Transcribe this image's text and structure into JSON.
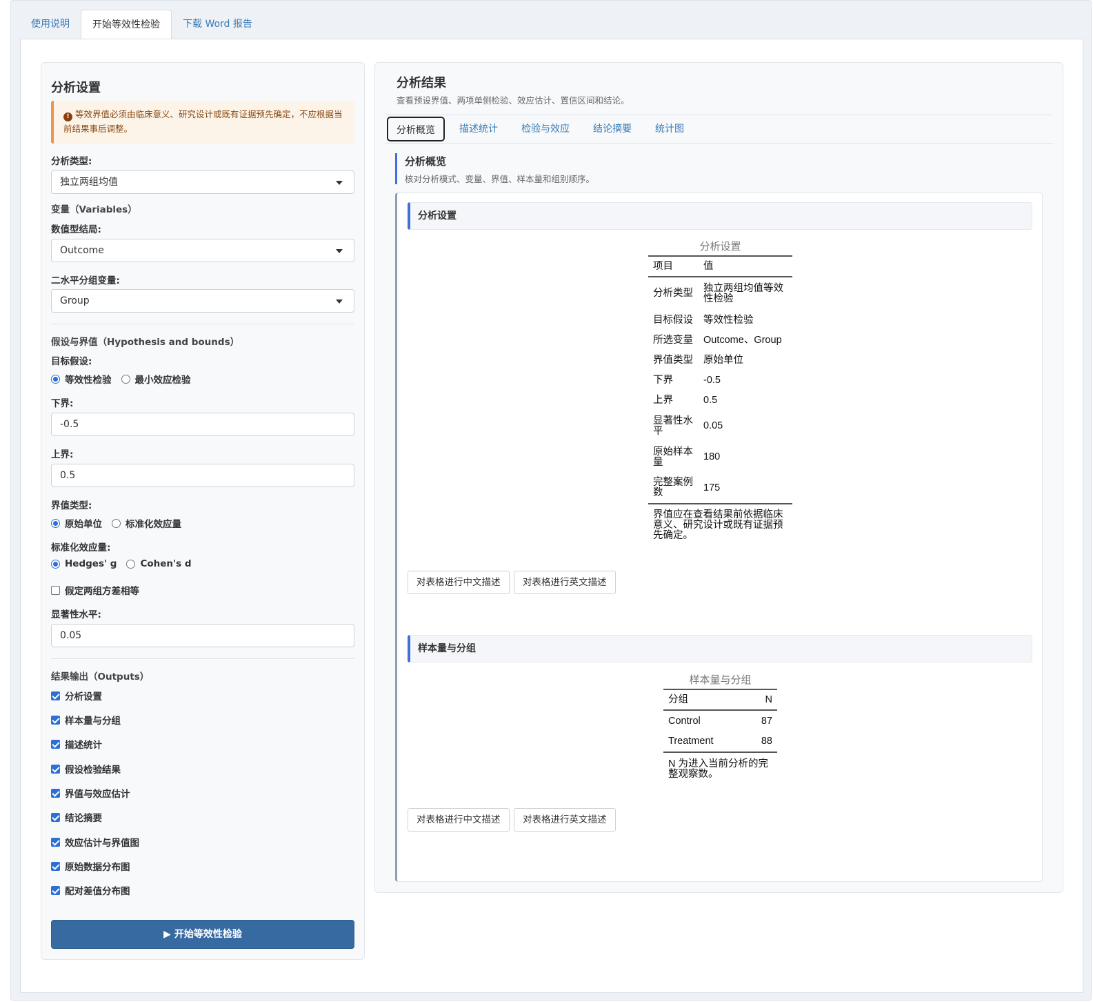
{
  "top_tabs": [
    "使用说明",
    "开始等效性检验",
    "下载 Word 报告"
  ],
  "sidebar": {
    "title": "分析设置",
    "warning": "等效界值必须由临床意义、研究设计或既有证据预先确定，不应根据当前结果事后调整。",
    "analysis_type_label": "分析类型:",
    "analysis_type_value": "独立两组均值",
    "variables_section": "变量（Variables）",
    "outcome_label": "数值型结局:",
    "outcome_value": "Outcome",
    "group_label": "二水平分组变量:",
    "group_value": "Group",
    "hypothesis_section": "假设与界值（Hypothesis and bounds）",
    "target_label": "目标假设:",
    "target_options": [
      "等效性检验",
      "最小效应检验"
    ],
    "lower_label": "下界:",
    "lower_value": "-0.5",
    "upper_label": "上界:",
    "upper_value": "0.5",
    "bound_type_label": "界值类型:",
    "bound_type_options": [
      "原始单位",
      "标准化效应量"
    ],
    "std_effect_label": "标准化效应量:",
    "std_effect_options": [
      "Hedges' g",
      "Cohen's d"
    ],
    "equal_var_label": "假定两组方差相等",
    "alpha_label": "显著性水平:",
    "alpha_value": "0.05",
    "outputs_section": "结果输出（Outputs）",
    "outputs": [
      "分析设置",
      "样本量与分组",
      "描述统计",
      "假设检验结果",
      "界值与效应估计",
      "结论摘要",
      "效应估计与界值图",
      "原始数据分布图",
      "配对差值分布图"
    ],
    "run_button": "开始等效性检验"
  },
  "results": {
    "title": "分析结果",
    "subtitle": "查看预设界值、两项单侧检验、效应估计、置信区间和结论。",
    "tabs": [
      "分析概览",
      "描述统计",
      "检验与效应",
      "结论摘要",
      "统计图"
    ],
    "overview_title": "分析概览",
    "overview_subtitle": "核对分析模式、变量、界值、样本量和组别顺序。",
    "settings_section": "分析设置",
    "settings_table": {
      "caption": "分析设置",
      "headers": [
        "项目",
        "值"
      ],
      "rows": [
        [
          "分析类型",
          "独立两组均值等效性检验"
        ],
        [
          "目标假设",
          "等效性检验"
        ],
        [
          "所选变量",
          "Outcome、Group"
        ],
        [
          "界值类型",
          "原始单位"
        ],
        [
          "下界",
          "-0.5"
        ],
        [
          "上界",
          "0.5"
        ],
        [
          "显著性水平",
          "0.05"
        ],
        [
          "原始样本量",
          "180"
        ],
        [
          "完整案例数",
          "175"
        ]
      ],
      "footnote": "界值应在查看结果前依据临床意义、研究设计或既有证据预先确定。"
    },
    "sample_section": "样本量与分组",
    "sample_table": {
      "caption": "样本量与分组",
      "headers": [
        "分组",
        "N"
      ],
      "rows": [
        [
          "Control",
          "87"
        ],
        [
          "Treatment",
          "88"
        ]
      ],
      "footnote": "N 为进入当前分析的完整观察数。"
    },
    "describe_cn": "对表格进行中文描述",
    "describe_en": "对表格进行英文描述"
  }
}
